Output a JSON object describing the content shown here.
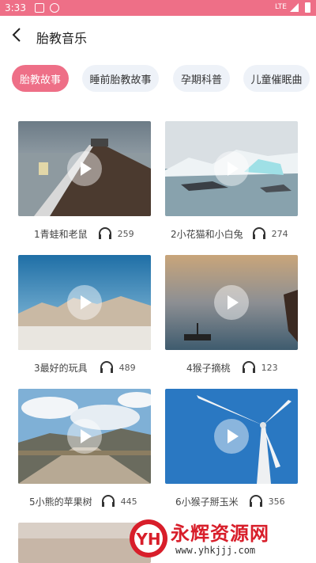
{
  "status_bar": {
    "time": "3:33",
    "network": "LTE"
  },
  "header": {
    "title": "胎教音乐"
  },
  "tabs": [
    {
      "label": "胎教故事",
      "active": true
    },
    {
      "label": "睡前胎教故事",
      "active": false
    },
    {
      "label": "孕期科普",
      "active": false
    },
    {
      "label": "儿童催眠曲",
      "active": false
    }
  ],
  "items": [
    {
      "title": "1青蛙和老鼠",
      "plays": "259",
      "scene": "pier"
    },
    {
      "title": "2小花猫和小白兔",
      "plays": "274",
      "scene": "icebergs"
    },
    {
      "title": "3最好的玩具",
      "plays": "489",
      "scene": "desert"
    },
    {
      "title": "4猴子摘桃",
      "plays": "123",
      "scene": "lake"
    },
    {
      "title": "5小熊的苹果树",
      "plays": "445",
      "scene": "road"
    },
    {
      "title": "6小猴子掰玉米",
      "plays": "356",
      "scene": "windmill"
    }
  ],
  "watermark": {
    "text": "永辉资源网",
    "url": "www.yhkjjj.com",
    "logo_text": "YH"
  },
  "colors": {
    "accent": "#ee6f87",
    "tab_bg": "#eef2f8"
  }
}
